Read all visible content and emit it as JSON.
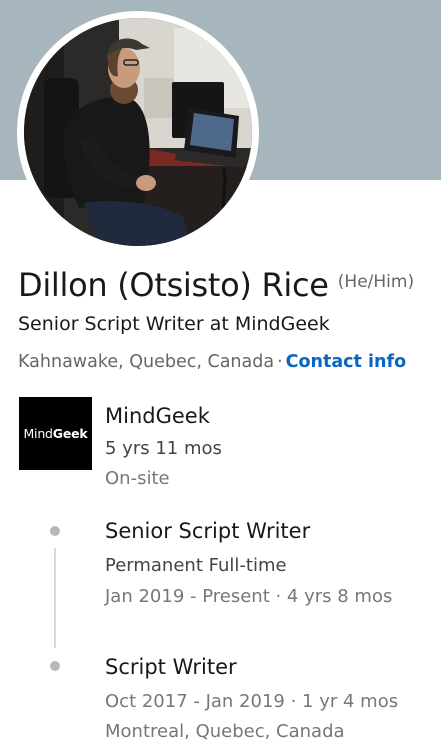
{
  "profile": {
    "name": "Dillon (Otsisto) Rice",
    "pronouns": "(He/Him)",
    "headline": "Senior Script Writer at MindGeek",
    "location": "Kahnawake, Quebec, Canada",
    "separator": "·",
    "contact_info": "Contact info",
    "avatar_icon": "profile-photo",
    "banner_color": "#a7b5bd",
    "link_color": "#0a66c2"
  },
  "experience": {
    "company": {
      "logo_text_light": "Mind",
      "logo_text_bold": "Geek",
      "name": "MindGeek",
      "duration": "5 yrs 11 mos",
      "work_type": "On-site"
    },
    "positions": [
      {
        "title": "Senior Script Writer",
        "employment_type": "Permanent Full-time",
        "dates": "Jan 2019 - Present · 4 yrs 8 mos"
      },
      {
        "title": "Script Writer",
        "dates": "Oct 2017 - Jan 2019 · 1 yr 4 mos",
        "location": "Montreal, Quebec, Canada"
      }
    ]
  }
}
